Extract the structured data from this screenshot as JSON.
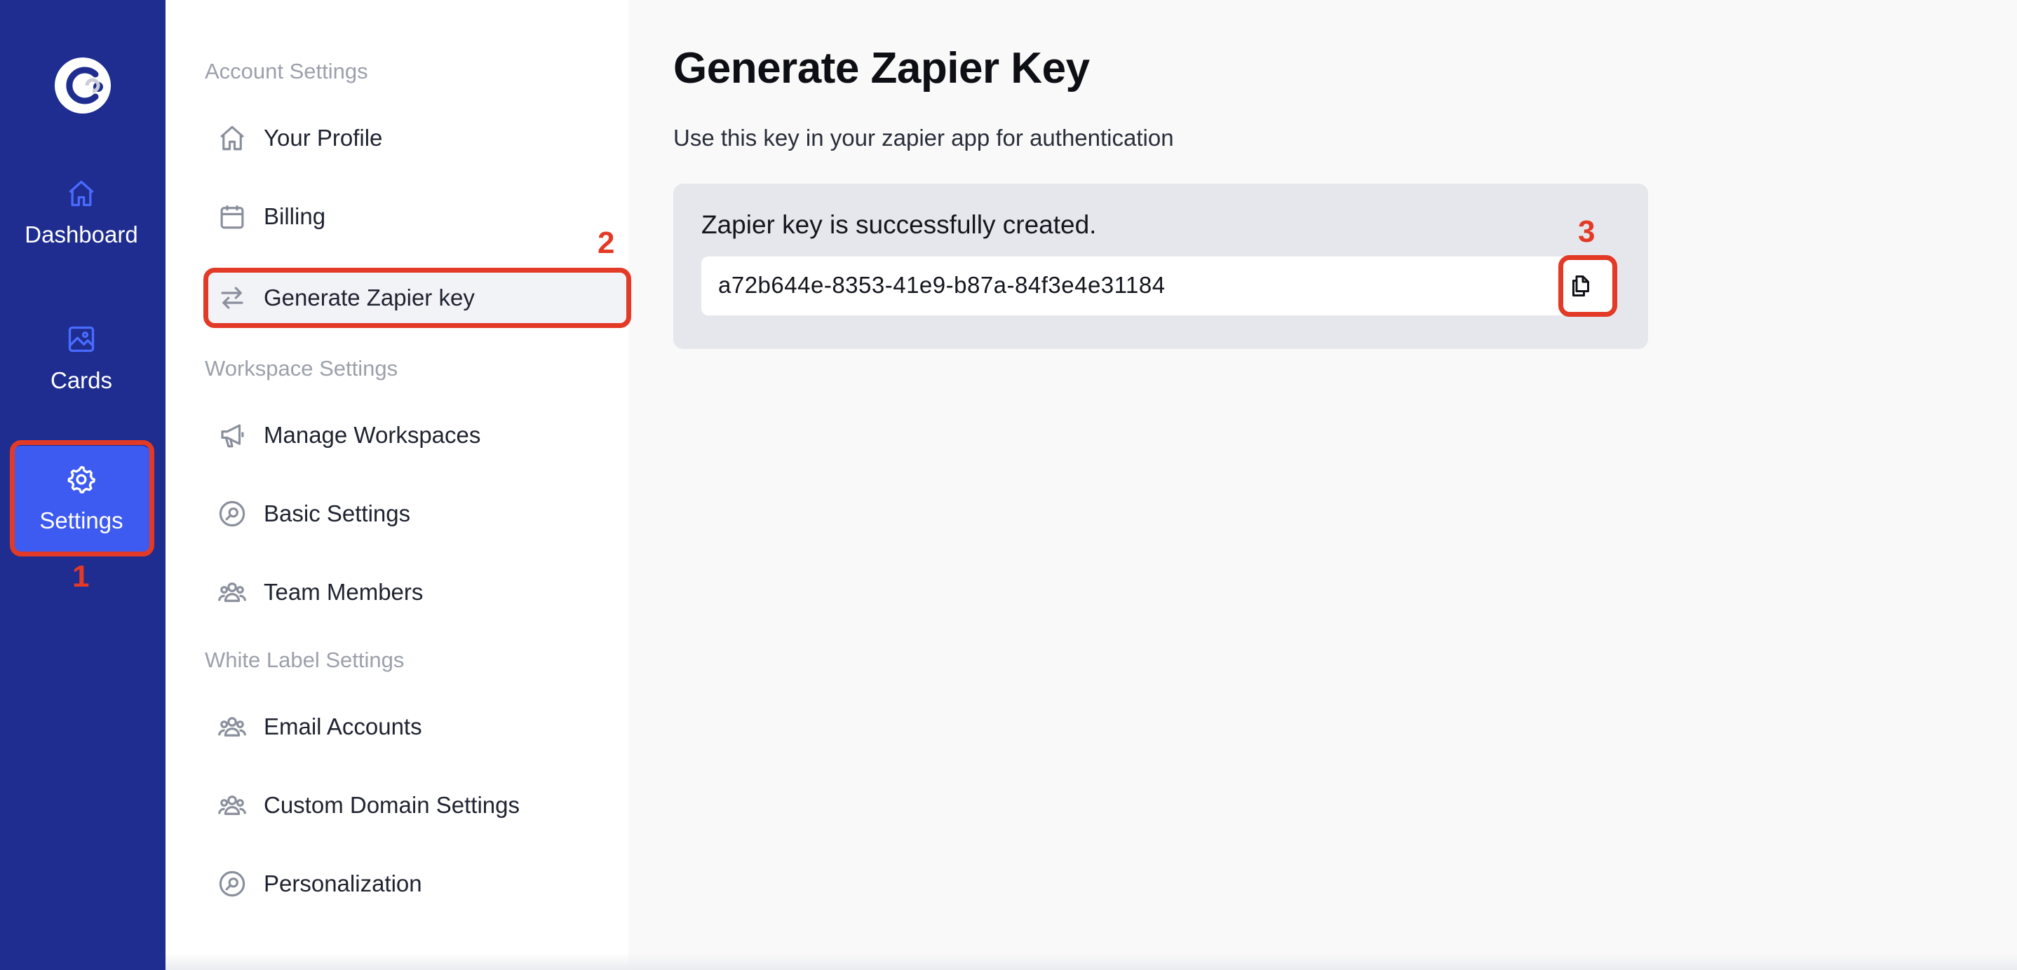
{
  "colors": {
    "rail_bg": "#1e2d8f",
    "rail_active": "#3d5af1",
    "annotation": "#e23a26"
  },
  "rail": {
    "items": [
      {
        "label": "Dashboard",
        "icon": "home-icon"
      },
      {
        "label": "Cards",
        "icon": "image-icon"
      },
      {
        "label": "Settings",
        "icon": "gear-icon",
        "active": true
      }
    ]
  },
  "menu": {
    "sections": [
      {
        "title": "Account Settings",
        "items": [
          {
            "label": "Your Profile",
            "icon": "home-icon"
          },
          {
            "label": "Billing",
            "icon": "calendar-icon"
          },
          {
            "label": "Generate Zapier key",
            "icon": "arrows-swap-icon",
            "active": true
          }
        ]
      },
      {
        "title": "Workspace Settings",
        "items": [
          {
            "label": "Manage Workspaces",
            "icon": "megaphone-icon"
          },
          {
            "label": "Basic Settings",
            "icon": "search-circle-icon"
          },
          {
            "label": "Team Members",
            "icon": "users-icon"
          }
        ]
      },
      {
        "title": "White Label Settings",
        "items": [
          {
            "label": "Email Accounts",
            "icon": "users-icon"
          },
          {
            "label": "Custom Domain Settings",
            "icon": "users-icon"
          },
          {
            "label": "Personalization",
            "icon": "search-circle-icon"
          }
        ]
      }
    ]
  },
  "main": {
    "title": "Generate Zapier Key",
    "subtitle": "Use this key in your zapier app for authentication",
    "status": "Zapier key is successfully created.",
    "key_value": "a72b644e-8353-41e9-b87a-84f3e4e31184",
    "copy_icon": "copy-icon"
  },
  "annotations": {
    "step1": "1",
    "step2": "2",
    "step3": "3"
  }
}
